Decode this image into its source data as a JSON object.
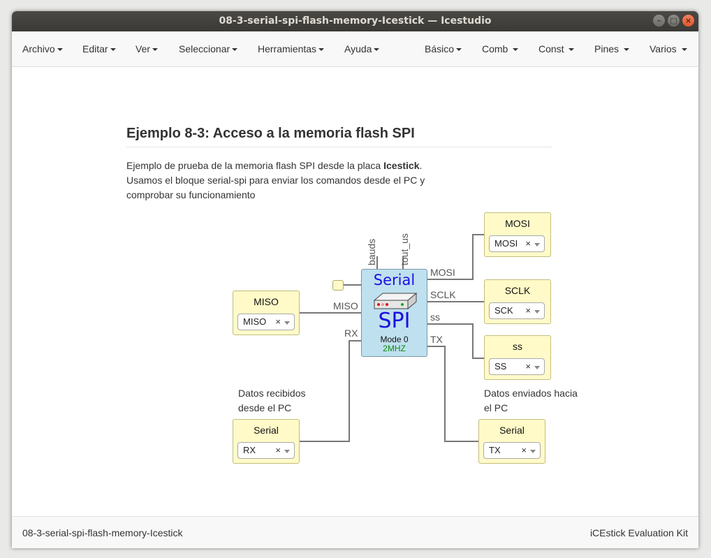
{
  "window": {
    "title": "08-3-serial-spi-flash-memory-Icestick — Icestudio",
    "buttons": [
      "–",
      "□",
      "×"
    ]
  },
  "menu": {
    "left": [
      "Archivo",
      "Editar",
      "Ver",
      "Seleccionar",
      "Herramientas",
      "Ayuda"
    ],
    "right": [
      "Básico",
      "Comb",
      "Const",
      "Pines",
      "Varios"
    ]
  },
  "doc": {
    "title": "Ejemplo 8-3: Acceso a la memoria flash SPI",
    "desc_line1_pre": "Ejemplo de prueba de la memoria flash SPI desde la placa ",
    "desc_line1_bold": "Icestick",
    "desc_line1_post": ".",
    "desc_line2": "Usamos el bloque serial-spi para enviar los comandos desde el PC y",
    "desc_line3": "comprobar su funcionamiento",
    "note_left_1": "Datos recibidos",
    "note_left_2": "desde el PC",
    "note_right_1": "Datos enviados hacia",
    "note_right_2": "el PC"
  },
  "blocks": {
    "mosi": {
      "label": "MOSI",
      "value": "MOSI"
    },
    "sclk": {
      "label": "SCLK",
      "value": "SCK"
    },
    "ss": {
      "label": "ss",
      "value": "SS"
    },
    "miso": {
      "label": "MISO",
      "value": "MISO"
    },
    "serial_rx": {
      "label": "Serial",
      "value": "RX"
    },
    "serial_tx": {
      "label": "Serial",
      "value": "TX"
    },
    "select_clear": "×"
  },
  "serial_spi": {
    "title": "Serial",
    "name": "SPI",
    "mode": "Mode 0",
    "freq": "2MHZ",
    "param_bauds": "bauds",
    "param_tout": "tout_us",
    "port_mosi": "MOSI",
    "port_sclk": "SCLK",
    "port_ss": "ss",
    "port_tx": "TX",
    "port_miso": "MISO",
    "port_rx": "RX"
  },
  "status": {
    "file": "08-3-serial-spi-flash-memory-Icestick",
    "board": "iCEstick Evaluation Kit"
  },
  "colors": {
    "titlebar": "#3d3c38",
    "io_fill": "#fffac8",
    "spi_block_fill": "#bfe0ef",
    "spi_text": "#1b10e0",
    "freq_text": "#0b8a0b",
    "wire": "#777777"
  }
}
